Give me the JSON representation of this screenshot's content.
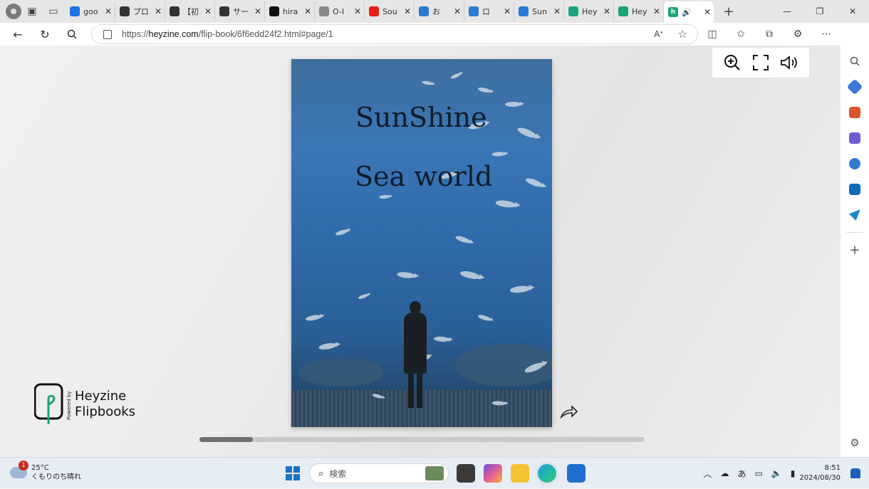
{
  "tabs": [
    {
      "favicon": "search-favicon",
      "color": "#1a73e8",
      "title": "goo"
    },
    {
      "favicon": "kuta-favicon",
      "color": "#333333",
      "title": "プロ"
    },
    {
      "favicon": "kuta-favicon",
      "color": "#333333",
      "title": "【初"
    },
    {
      "favicon": "kuta-favicon",
      "color": "#333333",
      "title": "サー"
    },
    {
      "favicon": "notion-favicon",
      "color": "#111111",
      "title": "hira"
    },
    {
      "favicon": "doc-favicon",
      "color": "#888888",
      "title": "O-I"
    },
    {
      "favicon": "youtube-favicon",
      "color": "#e62117",
      "title": "Sou"
    },
    {
      "favicon": "copilot-favicon",
      "color": "#2a7bd4",
      "title": "お"
    },
    {
      "favicon": "copilot-favicon",
      "color": "#2a7bd4",
      "title": "ロ"
    },
    {
      "favicon": "copilot-favicon",
      "color": "#2a7bd4",
      "title": "Sun"
    },
    {
      "favicon": "heyzine-favicon",
      "color": "#1aa37a",
      "title": "Hey"
    },
    {
      "favicon": "heyzine-favicon",
      "color": "#1aa37a",
      "title": "Hey"
    }
  ],
  "address_bar": {
    "url_prefix": "https://",
    "url_host": "heyzine.com",
    "url_path": "/flip-book/6f6edd24f2.html#page/1"
  },
  "flipbook": {
    "title_line1": "SunShine",
    "title_line2": "Sea world",
    "page": 1
  },
  "scroll": {
    "fraction": 0.12
  },
  "brand": {
    "powered": "Powered by",
    "line1": "Heyzine",
    "line2": "Flipbooks"
  },
  "taskbar": {
    "weather_temp": "25°C",
    "weather_desc": "くもりのち晴れ",
    "weather_badge": "1",
    "search_placeholder": "検索",
    "time": "8:51",
    "date": "2024/08/30",
    "ime": "あ"
  }
}
